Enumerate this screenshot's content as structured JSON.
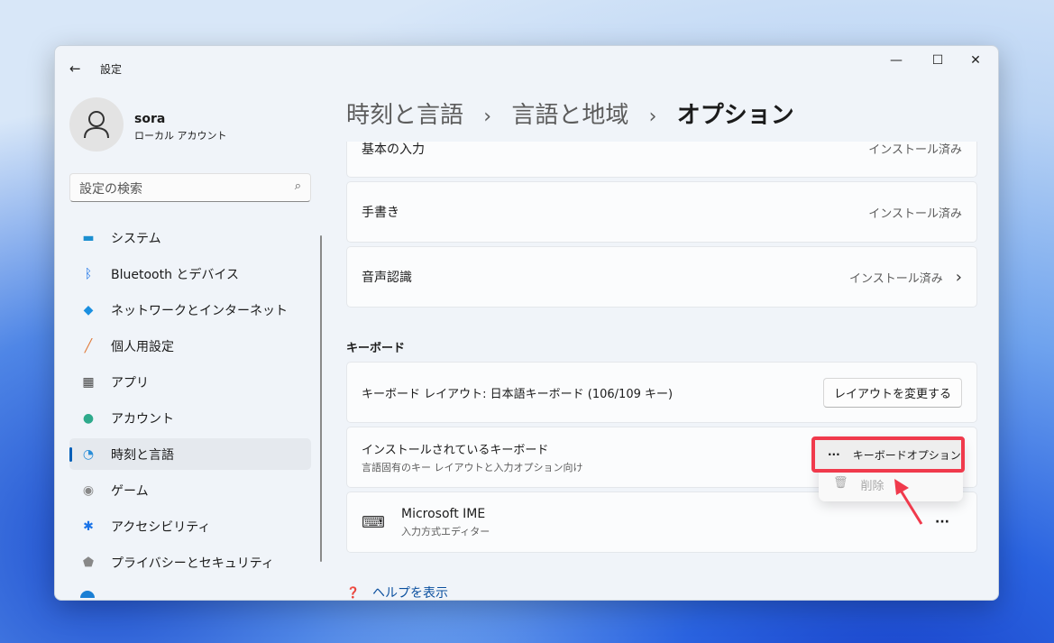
{
  "window": {
    "title": "設定",
    "minimize": "—",
    "maximize": "☐",
    "close": "✕"
  },
  "user": {
    "name": "sora",
    "account_type": "ローカル アカウント"
  },
  "search": {
    "placeholder": "設定の検索"
  },
  "sidebar": {
    "items": [
      {
        "label": "システム",
        "icon": "system-icon"
      },
      {
        "label": "Bluetooth とデバイス",
        "icon": "bluetooth-icon"
      },
      {
        "label": "ネットワークとインターネット",
        "icon": "wifi-icon"
      },
      {
        "label": "個人用設定",
        "icon": "brush-icon"
      },
      {
        "label": "アプリ",
        "icon": "apps-icon"
      },
      {
        "label": "アカウント",
        "icon": "account-icon"
      },
      {
        "label": "時刻と言語",
        "icon": "time-language-icon",
        "selected": true
      },
      {
        "label": "ゲーム",
        "icon": "gamepad-icon"
      },
      {
        "label": "アクセシビリティ",
        "icon": "accessibility-icon"
      },
      {
        "label": "プライバシーとセキュリティ",
        "icon": "shield-icon"
      }
    ]
  },
  "breadcrumb": {
    "level1": "時刻と言語",
    "level2": "言語と地域",
    "current": "オプション",
    "separator": "›"
  },
  "features": [
    {
      "label": "基本の入力",
      "status": "インストール済み"
    },
    {
      "label": "手書き",
      "status": "インストール済み"
    },
    {
      "label": "音声認識",
      "status": "インストール済み"
    }
  ],
  "keyboard": {
    "section_title": "キーボード",
    "layout_label": "キーボード レイアウト: 日本語キーボード (106/109 キー)",
    "change_layout_button": "レイアウトを変更する",
    "installed_title": "インストールされているキーボード",
    "installed_sub": "言語固有のキー レイアウトと入力オプション向け",
    "ime_name": "Microsoft IME",
    "ime_sub": "入力方式エディター",
    "more": "···"
  },
  "context_menu": {
    "options": "キーボードオプション",
    "remove": "削除",
    "more": "···"
  },
  "help": {
    "label": "ヘルプを表示"
  },
  "colors": {
    "accent": "#005fb8",
    "highlight": "#f03a4c"
  }
}
